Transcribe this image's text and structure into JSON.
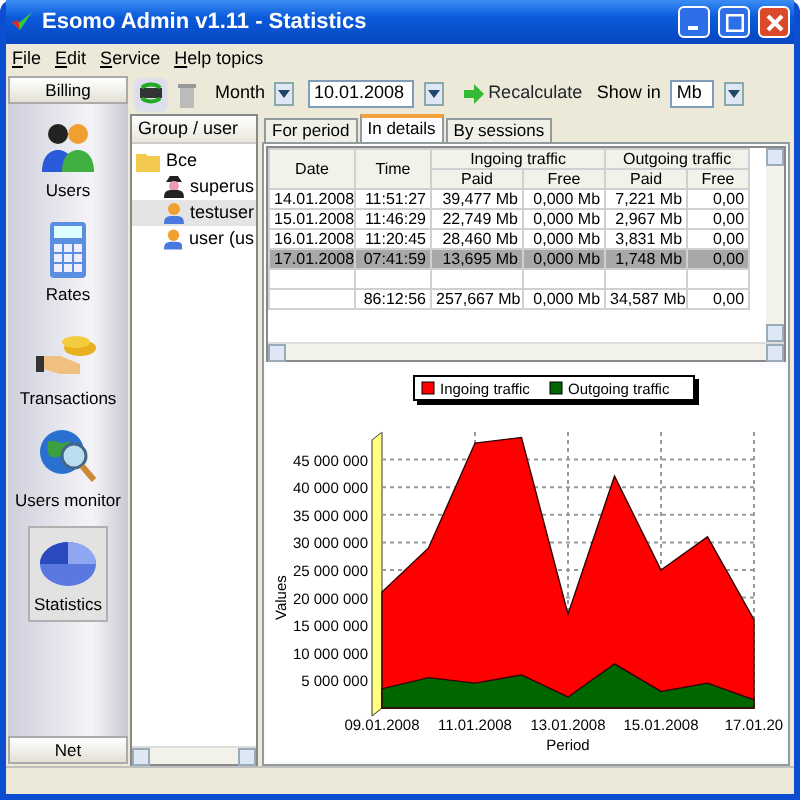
{
  "window": {
    "title": "Esomo Admin v1.11 - Statistics"
  },
  "menu": [
    {
      "label": "File"
    },
    {
      "label": "Edit"
    },
    {
      "label": "Service"
    },
    {
      "label": "Help topics"
    }
  ],
  "sidebar": {
    "top_button": "Billing",
    "bottom_button": "Net",
    "items": [
      {
        "label": "Users",
        "kind": "users",
        "selected": false
      },
      {
        "label": "Rates",
        "kind": "rates",
        "selected": false
      },
      {
        "label": "Transactions",
        "kind": "transactions",
        "selected": false
      },
      {
        "label": "Users monitor",
        "kind": "monitor",
        "selected": false
      },
      {
        "label": "Statistics",
        "kind": "statistics",
        "selected": true
      }
    ]
  },
  "toolbar": {
    "period": "Month",
    "date": "10.01.2008",
    "recalculate": "Recalculate",
    "show_in_label": "Show in",
    "unit": "Mb"
  },
  "tree": {
    "header": "Group / user",
    "items": [
      {
        "label": "Все",
        "kind": "group",
        "selected": false,
        "children": [
          {
            "label": "superus",
            "kind": "admin",
            "selected": false
          },
          {
            "label": "testuser",
            "kind": "user",
            "selected": true
          },
          {
            "label": "user (us",
            "kind": "user",
            "selected": false
          }
        ]
      }
    ]
  },
  "tabs": [
    {
      "label": "For period",
      "selected": false
    },
    {
      "label": "In details",
      "selected": true
    },
    {
      "label": "By sessions",
      "selected": false
    }
  ],
  "table": {
    "columns": [
      "Date",
      "Time"
    ],
    "groups": [
      {
        "label": "Ingoing traffic",
        "columns": [
          "Paid",
          "Free"
        ]
      },
      {
        "label": "Outgoing traffic",
        "columns": [
          "Paid",
          "Free"
        ]
      }
    ],
    "rows": [
      {
        "cells": [
          "14.01.2008",
          "11:51:27",
          "39,477 Mb",
          "0,000 Mb",
          "7,221 Mb",
          "0,00"
        ],
        "selected": false
      },
      {
        "cells": [
          "15.01.2008",
          "11:46:29",
          "22,749 Mb",
          "0,000 Mb",
          "2,967 Mb",
          "0,00"
        ],
        "selected": false
      },
      {
        "cells": [
          "16.01.2008",
          "11:20:45",
          "28,460 Mb",
          "0,000 Mb",
          "3,831 Mb",
          "0,00"
        ],
        "selected": false
      },
      {
        "cells": [
          "17.01.2008",
          "07:41:59",
          "13,695 Mb",
          "0,000 Mb",
          "1,748 Mb",
          "0,00"
        ],
        "selected": true
      }
    ],
    "total": [
      "86:12:56",
      "257,667 Mb",
      "0,000 Mb",
      "34,587 Mb",
      "0,00"
    ]
  },
  "chart_data": {
    "type": "area",
    "xlabel": "Period",
    "ylabel": "Values",
    "categories": [
      "09.01.2008",
      null,
      "11.01.2008",
      null,
      "13.01.2008",
      null,
      "15.01.2008",
      null,
      "17.01.20"
    ],
    "ylim": [
      0,
      50000000
    ],
    "grid": true,
    "series": [
      {
        "name": "Ingoing traffic",
        "color": "#ff0000",
        "values": [
          21000000,
          29000000,
          48000000,
          49000000,
          17000000,
          42000000,
          25000000,
          31000000,
          16000000
        ]
      },
      {
        "name": "Outgoing traffic",
        "color": "#006600",
        "values": [
          3500000,
          5500000,
          4500000,
          6000000,
          2000000,
          8000000,
          3000000,
          4500000,
          1500000
        ]
      }
    ],
    "yticks": [
      {
        "value": 5000000,
        "label": "5 000 000"
      },
      {
        "value": 10000000,
        "label": "10 000 000"
      },
      {
        "value": 15000000,
        "label": "15 000 000"
      },
      {
        "value": 20000000,
        "label": "20 000 000"
      },
      {
        "value": 25000000,
        "label": "25 000 000"
      },
      {
        "value": 30000000,
        "label": "30 000 000"
      },
      {
        "value": 35000000,
        "label": "35 000 000"
      },
      {
        "value": 40000000,
        "label": "40 000 000"
      },
      {
        "value": 45000000,
        "label": "45 000 000"
      }
    ]
  }
}
